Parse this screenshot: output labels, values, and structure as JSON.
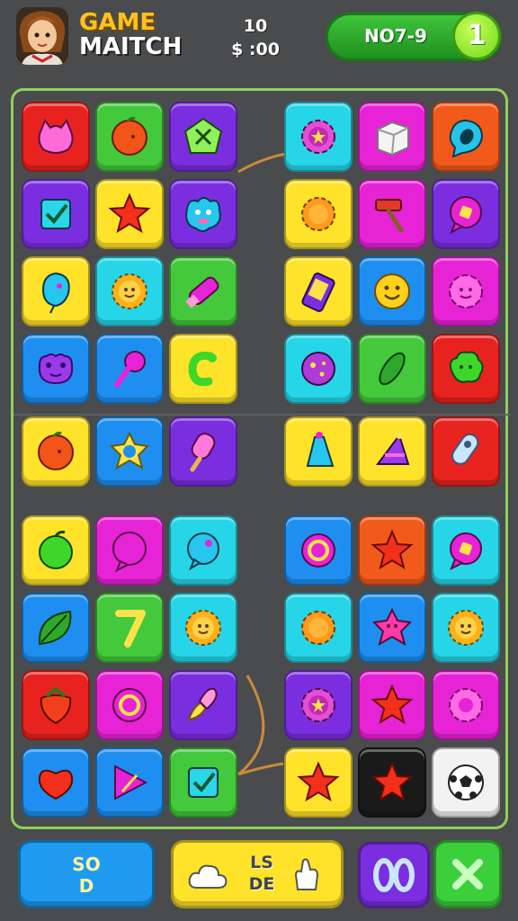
{
  "header": {
    "title_line1": "GAME",
    "title_line2": "MAITCH",
    "score_top": "10",
    "score_bottom": "$ :00",
    "level_text": "NO7-9",
    "level_badge": "1"
  },
  "colors": {
    "red": "#e8231f",
    "green": "#43c93b",
    "purple": "#7a2ee0",
    "cyan": "#26d6e8",
    "magenta": "#e624d6",
    "orange": "#f25a1c",
    "yellow": "#ffe32a",
    "blue": "#1e8ff0",
    "black": "#1a1a1a",
    "white": "#f2f2f2",
    "lime": "#3fd62a"
  },
  "grid": {
    "rows": [
      [
        {
          "bg": "red",
          "icon": "cat-blob"
        },
        {
          "bg": "green",
          "icon": "orange-fruit"
        },
        {
          "bg": "purple",
          "icon": "pentagon-scissors"
        },
        {
          "bg": "cyan",
          "icon": "gear-star"
        },
        {
          "bg": "magenta",
          "icon": "ice-cube"
        },
        {
          "bg": "orange",
          "icon": "speech-drop"
        }
      ],
      [
        {
          "bg": "purple",
          "icon": "checkbox"
        },
        {
          "bg": "yellow",
          "icon": "star"
        },
        {
          "bg": "purple",
          "icon": "blob-monster"
        },
        {
          "bg": "yellow",
          "icon": "sun-gear"
        },
        {
          "bg": "magenta",
          "icon": "hammer"
        },
        {
          "bg": "purple",
          "icon": "speech-badge"
        }
      ],
      [
        {
          "bg": "yellow",
          "icon": "balloon"
        },
        {
          "bg": "cyan",
          "icon": "sun-face"
        },
        {
          "bg": "green",
          "icon": "eraser"
        },
        {
          "bg": "yellow",
          "icon": "phone"
        },
        {
          "bg": "blue",
          "icon": "smile-bubble"
        },
        {
          "bg": "magenta",
          "icon": "flower-face"
        }
      ],
      [
        {
          "bg": "blue",
          "icon": "frog"
        },
        {
          "bg": "blue",
          "icon": "lollipop"
        },
        {
          "bg": "yellow",
          "icon": "hook"
        },
        {
          "bg": "cyan",
          "icon": "ball"
        },
        {
          "bg": "green",
          "icon": "cucumber"
        },
        {
          "bg": "red",
          "icon": "tree-blob"
        }
      ],
      [
        {
          "bg": "yellow",
          "icon": "orange-fruit"
        },
        {
          "bg": "blue",
          "icon": "flower"
        },
        {
          "bg": "purple",
          "icon": "popsicle"
        },
        {
          "bg": "yellow",
          "icon": "bell-cone"
        },
        {
          "bg": "yellow",
          "icon": "cone-hat"
        },
        {
          "bg": "red",
          "icon": "pin-sticker"
        }
      ],
      [
        {
          "bg": "yellow",
          "icon": "apple"
        },
        {
          "bg": "magenta",
          "icon": "speech-round"
        },
        {
          "bg": "cyan",
          "icon": "balloon-bubble"
        },
        {
          "bg": "blue",
          "icon": "ring"
        },
        {
          "bg": "orange",
          "icon": "star"
        },
        {
          "bg": "cyan",
          "icon": "speech-badge"
        }
      ],
      [
        {
          "bg": "blue",
          "icon": "leaf"
        },
        {
          "bg": "green",
          "icon": "seven"
        },
        {
          "bg": "cyan",
          "icon": "sun-face"
        },
        {
          "bg": "cyan",
          "icon": "sun-gear"
        },
        {
          "bg": "blue",
          "icon": "star-blob"
        },
        {
          "bg": "cyan",
          "icon": "sun-face"
        }
      ],
      [
        {
          "bg": "red",
          "icon": "strawberry"
        },
        {
          "bg": "magenta",
          "icon": "ring"
        },
        {
          "bg": "purple",
          "icon": "brush"
        },
        {
          "bg": "purple",
          "icon": "gear-star"
        },
        {
          "bg": "magenta",
          "icon": "star"
        },
        {
          "bg": "magenta",
          "icon": "gear"
        }
      ],
      [
        {
          "bg": "blue",
          "icon": "cloud-heart"
        },
        {
          "bg": "blue",
          "icon": "triangle-pen"
        },
        {
          "bg": "green",
          "icon": "checkbox"
        },
        {
          "bg": "yellow",
          "icon": "star"
        },
        {
          "bg": "black",
          "icon": "star"
        },
        {
          "bg": "white",
          "icon": "soccer-ball"
        }
      ]
    ]
  },
  "bottom": {
    "blue_line1": "SO",
    "blue_line2": "D",
    "yellow_line1": "LS",
    "yellow_line2": "DE",
    "purple_icon": "infinity-icon",
    "green_icon": "close-icon"
  }
}
